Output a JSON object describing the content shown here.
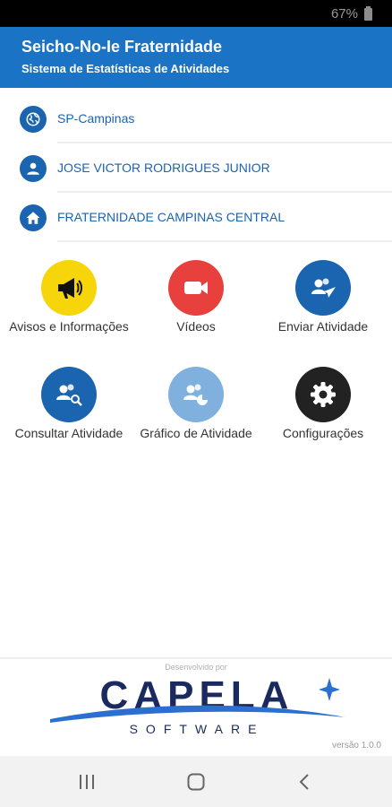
{
  "status": {
    "battery_text": "67%"
  },
  "header": {
    "title": "Seicho-No-Ie Fraternidade",
    "subtitle": "Sistema de Estatísticas de Atividades"
  },
  "info_rows": [
    {
      "label": "SP-Campinas",
      "icon": "globe-icon"
    },
    {
      "label": "JOSE VICTOR RODRIGUES JUNIOR",
      "icon": "person-icon"
    },
    {
      "label": "FRATERNIDADE CAMPINAS CENTRAL",
      "icon": "home-icon"
    }
  ],
  "tiles": [
    {
      "label": "Avisos e Informações",
      "icon": "megaphone-icon",
      "color": "#f6d50a"
    },
    {
      "label": "Vídeos",
      "icon": "video-camera-icon",
      "color": "#e8403c"
    },
    {
      "label": "Enviar Atividade",
      "icon": "send-users-icon",
      "color": "#1a64b0"
    },
    {
      "label": "Consultar Atividade",
      "icon": "search-users-icon",
      "color": "#1a64b0"
    },
    {
      "label": "Gráfico de Atividade",
      "icon": "users-chart-icon",
      "color": "#7fb0de"
    },
    {
      "label": "Configurações",
      "icon": "gear-icon",
      "color": "#222222"
    }
  ],
  "footer": {
    "developed_by": "Desenvolvido por",
    "logo_main": "CAPELA",
    "logo_sub": "SOFTWARE",
    "version": "versão 1.0.0"
  },
  "nav": {
    "recents_icon": "recents-icon",
    "home_icon": "home-circle-icon",
    "back_icon": "back-chevron-icon"
  },
  "colors": {
    "primary": "#1a73c4",
    "dark_blue": "#1a64b0"
  }
}
